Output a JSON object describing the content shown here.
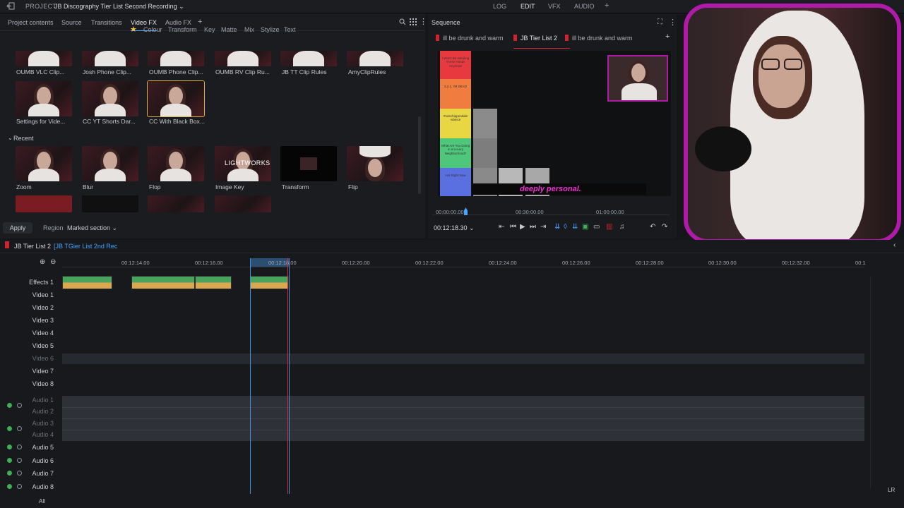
{
  "topbar": {
    "project_label": "PROJECT",
    "project_title": "JB Discography Tier List Second Recording ⌄",
    "modes": [
      "LOG",
      "EDIT",
      "VFX",
      "AUDIO",
      "+"
    ],
    "active_mode": "EDIT"
  },
  "left_panel": {
    "tabs": [
      "Project contents",
      "Source",
      "Transitions",
      "Video FX",
      "Audio FX",
      "+"
    ],
    "active_tab": "Video FX",
    "subtabs": [
      "Colour",
      "Transform",
      "Key",
      "Matte",
      "Mix",
      "Stylize",
      "Text"
    ],
    "clips_row1": [
      "OUMB VLC Clip...",
      "Josh Phone Clip...",
      "OUMB Phone Clip...",
      "OUMB RV Clip Ru...",
      "JB TT Clip Rules",
      "AmyClipRules"
    ],
    "clips_row2": [
      "Settings for Vide...",
      "CC YT Shorts Dar...",
      "CC With Black Box..."
    ],
    "recent_header": "Recent",
    "recent": [
      "Zoom",
      "Blur",
      "Flop",
      "Image Key",
      "Transform",
      "Flip"
    ],
    "lightworks_label": "LIGHTWORKS",
    "apply_label": "Apply",
    "region_label": "Region",
    "region_value": "Marked section ⌄"
  },
  "sequence": {
    "title": "Sequence",
    "tabs": [
      "ill be drunk and warm",
      "JB Tier List 2",
      "ill be drunk and warm"
    ],
    "active_tab": "JB Tier List 2",
    "tier_labels": [
      "I Won't Be Needing These Hands Anymore",
      "3,2,1, I'M DEAD",
      "#rulechippendale sdance",
      "What Are You Doing in a Luxury Neighborhood?",
      "Hot Right Now"
    ],
    "overlay_text": "deeply personal.",
    "ruler": [
      "00:00:00.00",
      "00:30:00.00",
      "01:00:00.00"
    ],
    "timecode": "00:12:18.30 ⌄"
  },
  "timeline": {
    "name": "JB Tier List 2",
    "subtitle": "[JB TGier List 2nd Rec",
    "timecodes": [
      "00:12:14.00",
      "00:12:16.00",
      "00:12:18.00",
      "00:12:20.00",
      "00:12:22.00",
      "00:12:24.00",
      "00:12:26.00",
      "00:12:28.00",
      "00:12:30.00",
      "00:12:32.00",
      "00:1"
    ],
    "tracks": [
      "Effects 1",
      "Video 1",
      "Video 2",
      "Video 3",
      "Video 4",
      "Video 5",
      "Video 6",
      "Video 7",
      "Video 8",
      "Audio 1",
      "Audio 2",
      "Audio 3",
      "Audio 4",
      "Audio 5",
      "Audio 6",
      "Audio 7",
      "Audio 8"
    ],
    "all_label": "All",
    "lr_label": "LR"
  },
  "colors": {
    "accent": "#4aa3ff",
    "record_red": "#d0232d",
    "webcam_border": "#b01aa8",
    "clip_green": "#49a35c",
    "clip_gold": "#d9a851",
    "overlay_pink": "#f02fd0"
  }
}
